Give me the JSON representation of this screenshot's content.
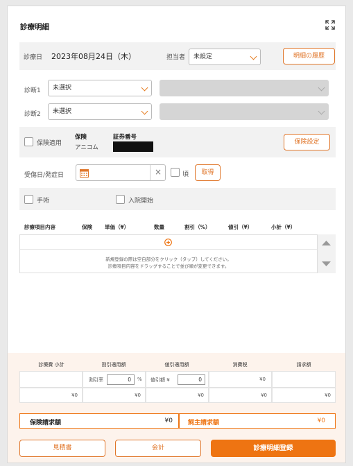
{
  "title": "診療明細",
  "header": {
    "date_label": "診療日",
    "date_value": "2023年08月24日（木）",
    "staff_label": "担当者",
    "staff_value": "未設定",
    "history_button": "明細の履歴"
  },
  "diagnosis": [
    {
      "label": "診断1",
      "value": "未選択"
    },
    {
      "label": "診断2",
      "value": "未選択"
    }
  ],
  "insurance": {
    "apply_label": "保険適用",
    "insurance_title": "保険",
    "insurance_name": "アニコム",
    "cert_title": "証券番号",
    "settings_button": "保険設定"
  },
  "injury": {
    "label": "受傷日/発症日",
    "clear_glyph": "×",
    "approx_label": "頃",
    "get_button": "取得"
  },
  "flags": {
    "surgery_label": "手術",
    "admission_label": "入院開始"
  },
  "table": {
    "headers": [
      "診療項目内容",
      "保険",
      "単価（¥）",
      "数量",
      "割引（%）",
      "値引（¥）",
      "小計（¥）"
    ],
    "hint_line1": "新規登録の際は空白部分をクリック（タップ）してください。",
    "hint_line2": "診療項目内容をドラッグすることで並び順が変更できます。"
  },
  "summary": {
    "headers": [
      "診療費 小計",
      "割引適用額",
      "値引適用額",
      "消費税",
      "請求額"
    ],
    "discount_rate_label": "割引率",
    "discount_rate_value": "0",
    "percent_unit": "%",
    "discount_amount_label": "値引額 ¥",
    "discount_amount_value": "0",
    "tax_row1": "¥0",
    "values": [
      "¥0",
      "¥0",
      "¥0",
      "¥0",
      "¥0"
    ]
  },
  "totals": {
    "insurance_label": "保険請求額",
    "insurance_value": "¥0",
    "owner_label": "飼主請求額",
    "owner_value": "¥0"
  },
  "actions": {
    "estimate": "見積書",
    "checkout": "会計",
    "register": "診療明細登録"
  },
  "colors": {
    "accent": "#ee7412",
    "accent_border": "#e0762a",
    "bottom_bg": "#fdf3ec"
  }
}
